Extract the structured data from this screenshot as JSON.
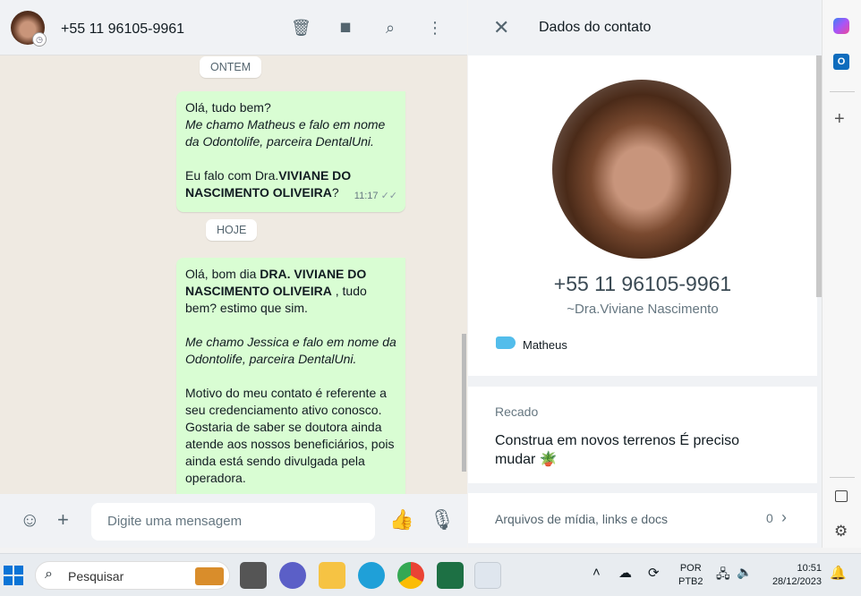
{
  "chat": {
    "contact": "+55 11 96105-9961",
    "day1": "ONTEM",
    "day2": "HOJE",
    "msg1": {
      "l1": "Olá, tudo bem?",
      "l2": "Me chamo Matheus e falo em nome da Odontolife, parceira DentalUni.",
      "l3a": "Eu falo com Dra.",
      "l3b": "VIVIANE DO NASCIMENTO OLIVEIRA",
      "l3c": "?",
      "time": "11:17"
    },
    "msg2": {
      "a": "Olá, bom dia ",
      "b": "DRA. VIVIANE DO NASCIMENTO OLIVEIRA",
      "c": " , tudo bem? estimo que sim.",
      "d": "Me chamo Jessica e falo em nome da Odontolife, parceira DentalUni.",
      "e": "Motivo do meu contato é referente a seu credenciamento ativo conosco. Gostaria de saber se doutora ainda atende aos nossos beneficiários, pois ainda está sendo divulgada pela operadora."
    },
    "placeholder": "Digite uma mensagem"
  },
  "info": {
    "title": "Dados do contato",
    "phone": "+55 11 96105-9961",
    "name": "~Dra.Viviane Nascimento",
    "label": "Matheus",
    "about_title": "Recado",
    "about": "Construa em novos terrenos É preciso mudar 🪴",
    "media": "Arquivos de mídia, links e docs",
    "media_count": "0"
  },
  "taskbar": {
    "search": "Pesquisar",
    "lang1": "POR",
    "lang2": "PTB2",
    "time": "10:51",
    "date": "28/12/2023"
  }
}
